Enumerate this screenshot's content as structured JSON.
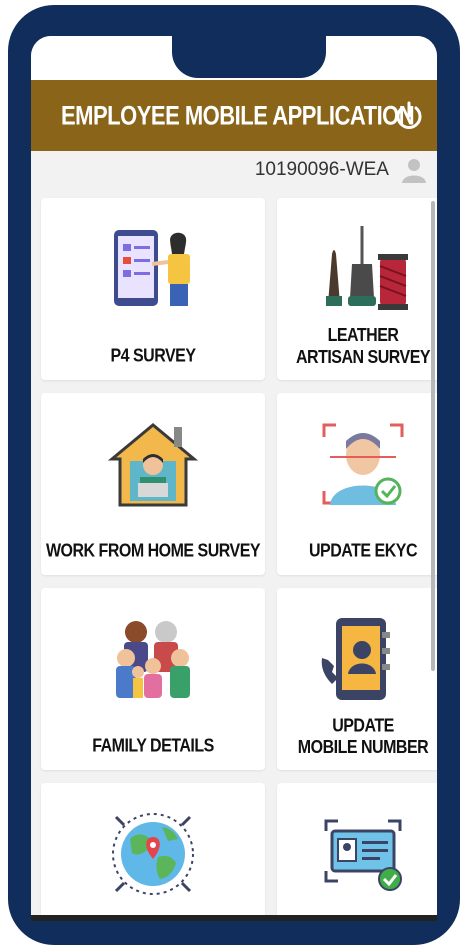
{
  "header": {
    "title": "EMPLOYEE MOBILE APPLICATION",
    "power_icon": "power-icon"
  },
  "user": {
    "id": "10190096-WEA",
    "icon": "user-icon"
  },
  "tiles": [
    {
      "label": "P4 SURVEY",
      "icon": "survey-phone-person-icon"
    },
    {
      "label": "LEATHER\nARTISAN SURVEY",
      "icon": "leather-tools-icon"
    },
    {
      "label": "WORK FROM HOME SURVEY",
      "icon": "work-from-home-icon"
    },
    {
      "label": "UPDATE EKYC",
      "icon": "face-verify-icon"
    },
    {
      "label": "FAMILY DETAILS",
      "icon": "family-icon"
    },
    {
      "label": "UPDATE\nMOBILE NUMBER",
      "icon": "phone-contact-book-icon"
    },
    {
      "label": "",
      "icon": "globe-location-icon"
    },
    {
      "label": "",
      "icon": "id-card-verify-icon"
    }
  ],
  "colors": {
    "header": "#8a6418",
    "frame": "#112d5b",
    "background": "#f2f2f2"
  }
}
